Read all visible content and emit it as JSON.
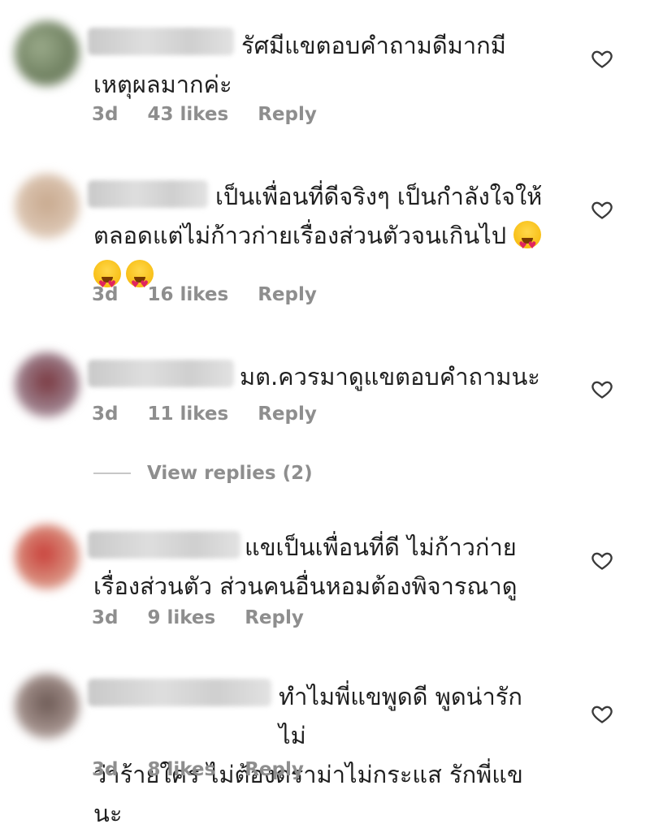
{
  "comments": [
    {
      "line1": "รัศมีแขตอบคำถามดีมากมี",
      "line2": "เหตุผลมากค่ะ",
      "time": "3d",
      "likes": "43 likes",
      "reply": "Reply"
    },
    {
      "line1": "เป็นเพื่อนที่ดีจริงๆ เป็นกำลังใจให้",
      "line2": "ตลอดแต่ไม่ก้าวก่ายเรื่องส่วนตัวจนเกินไป",
      "time": "3d",
      "likes": "16 likes",
      "reply": "Reply"
    },
    {
      "line1": "มต.ควรมาดูแขตอบคำถามนะ",
      "time": "3d",
      "likes": "11 likes",
      "reply": "Reply"
    },
    {
      "line1": "แขเป็นเพื่อนที่ดี ไม่ก้าวก่าย",
      "line2": "เรื่องส่วนตัว ส่วนคนอื่นหอมต้องพิจารณาดู",
      "time": "3d",
      "likes": "9 likes",
      "reply": "Reply"
    },
    {
      "line1": "ทำไมพี่แขพูดดี พูดน่ารักไม่",
      "line2": "ว่าร้ายใคร ไม่ต้องดราม่าไม่กระแส รักพี่แขนะ",
      "time": "3d",
      "likes": "8 likes",
      "reply": "Reply"
    }
  ],
  "view_replies": "View replies (2)",
  "icons": {
    "like": "heart-outline-icon",
    "emoji": "heart-eyes-emoji-icon"
  },
  "colors": {
    "text": "#1f1f1f",
    "meta": "#8e8e8e"
  }
}
